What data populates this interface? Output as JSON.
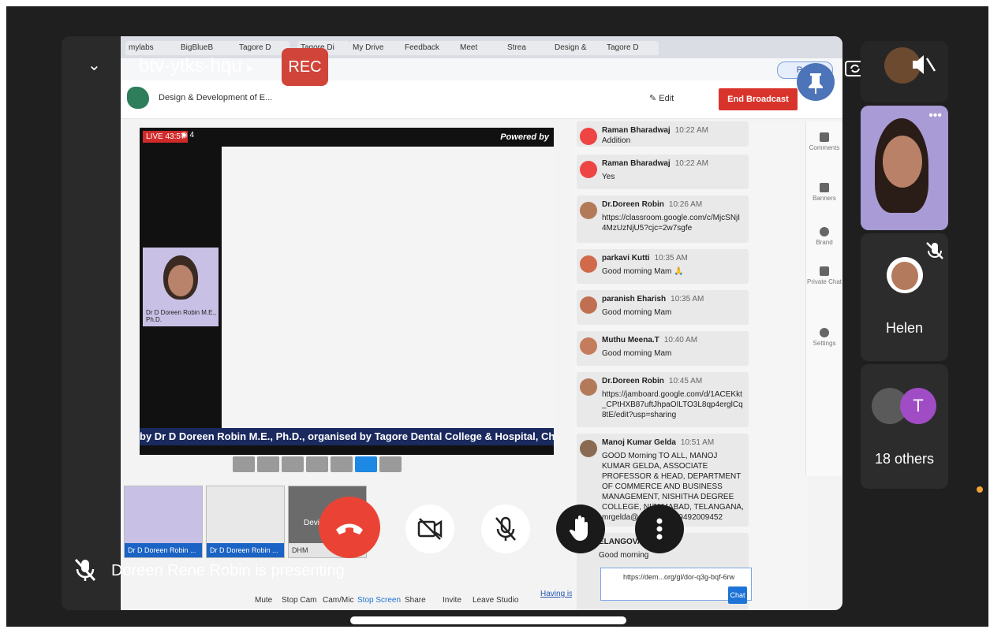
{
  "meeting": {
    "code": "btv-ytks-hqu",
    "rec": "REC",
    "presenting": "Doreen Rene Robin is presenting"
  },
  "browser": {
    "tabs": [
      "mylabs",
      "BigBlueB",
      "Tagore D",
      "Tagore Di",
      "My Drive",
      "Feedback",
      "Meet",
      "Strea",
      "Design &",
      "Tagore D"
    ],
    "paused": "Paused"
  },
  "studio": {
    "title": "Design & Development of E...",
    "edit": "Edit",
    "end_broadcast": "End Broadcast",
    "live": "LIVE 43:57",
    "viewers": "4",
    "powered_by": "Powered by",
    "ticker": "by Dr D Doreen Robin M.E., Ph.D., organised by Tagore Dental College & Hospital, Chennai on",
    "speaker_label": "Dr D Doreen Robin M.E., Ph.D.",
    "thumbs": [
      {
        "label": "Dr D Doreen Robin ..."
      },
      {
        "label": "Dr D Doreen Robin ..."
      },
      {
        "label": "DHM",
        "status": "Devices not c"
      }
    ],
    "controls": [
      "Mute",
      "Stop Cam",
      "Cam/Mic",
      "Stop Screen",
      "Share",
      "Invite",
      "Leave Studio"
    ],
    "having_issues": "Having issues?",
    "side_nav": [
      "Comments",
      "Banners",
      "Brand",
      "Private Chat",
      "Settings"
    ],
    "chat_button": "Chat",
    "chat_input": "https://dem...org/gl/dor-q3g-bqf-6rw"
  },
  "comments": [
    {
      "name": "Raman Bharadwaj",
      "time": "10:22 AM",
      "text": "Addition"
    },
    {
      "name": "Raman Bharadwaj",
      "time": "10:22 AM",
      "text": "Yes"
    },
    {
      "name": "Dr.Doreen Robin",
      "time": "10:26 AM",
      "text": "https://classroom.google.com/c/MjcSNjI4MzUzNjU5?cjc=2w7sgfe"
    },
    {
      "name": "parkavi Kutti",
      "time": "10:35 AM",
      "text": "Good morning Mam 🙏"
    },
    {
      "name": "paranish Eharish",
      "time": "10:35 AM",
      "text": "Good morning Mam"
    },
    {
      "name": "Muthu Meena.T",
      "time": "10:40 AM",
      "text": "Good morning Mam"
    },
    {
      "name": "Dr.Doreen Robin",
      "time": "10:45 AM",
      "text": "https://jamboard.google.com/d/1ACEKkt_CPtHXB87uftJhpaOILTO3L8qp4erglCq8tE/edit?usp=sharing"
    },
    {
      "name": "Manoj Kumar Gelda",
      "time": "10:51 AM",
      "text": "GOOD Morning TO ALL, MANOJ KUMAR GELDA, ASSOCIATE PROFESSOR & HEAD, DEPARTMENT OF COMMERCE AND BUSINESS MANAGEMENT, NISHITHA DEGREE COLLEGE, NIZAMABAD, TELANGANA, mrgelda@gmail.com, 9492009452"
    },
    {
      "name": "ELANGOVAN M",
      "time": "",
      "text": "Good morning"
    }
  ],
  "participants": {
    "helen": "Helen",
    "others": "18 others",
    "others_initial": "T"
  },
  "colors": {
    "rec": "#d0443a",
    "hangup": "#ea4335",
    "pin": "#4d74b8",
    "end_broadcast": "#d9342b",
    "ticker": "#1a2a5e"
  }
}
